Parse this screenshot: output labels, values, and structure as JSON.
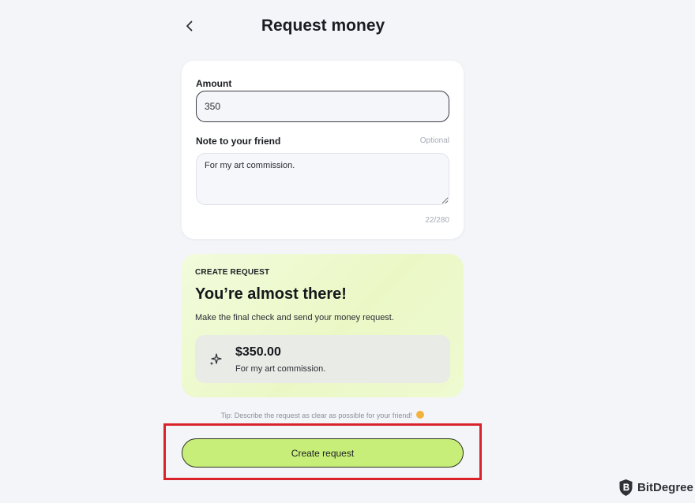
{
  "header": {
    "back_icon": "chevron-left-icon",
    "title": "Request money"
  },
  "form": {
    "amount_label": "Amount",
    "amount_value": "350",
    "note_label": "Note to your friend",
    "note_optional": "Optional",
    "note_value": "For my art commission.",
    "char_count": "22/280"
  },
  "summary": {
    "eyebrow": "CREATE REQUEST",
    "heading": "You’re almost there!",
    "subtext": "Make the final check and send your money request.",
    "icon": "sparkle-icon",
    "amount": "$350.00",
    "note": "For my art commission."
  },
  "tip": "Tip: Describe the request as clear as possible for your friend!",
  "tip_emoji": "grinning-emoji",
  "cta": {
    "label": "Create request",
    "color": "#c8ee7a"
  },
  "annotation": {
    "highlight_color": "#d9232a"
  },
  "watermark": {
    "icon": "bitdegree-shield-icon",
    "text": "BitDegree"
  }
}
